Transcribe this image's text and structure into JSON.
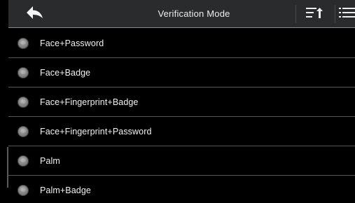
{
  "header": {
    "title": "Verification Mode",
    "back_icon": "back-arrow-icon",
    "sort_icon": "sort-upload-icon",
    "menu_icon": "list-menu-icon"
  },
  "items": [
    {
      "label": "Face+Password"
    },
    {
      "label": "Face+Badge"
    },
    {
      "label": "Face+Fingerprint+Badge"
    },
    {
      "label": "Face+Fingerprint+Password"
    },
    {
      "label": "Palm"
    },
    {
      "label": "Palm+Badge"
    }
  ],
  "colors": {
    "header_bg": "#2a2b2d",
    "background": "#000000",
    "text": "#f2f2f2",
    "divider": "#565656"
  }
}
